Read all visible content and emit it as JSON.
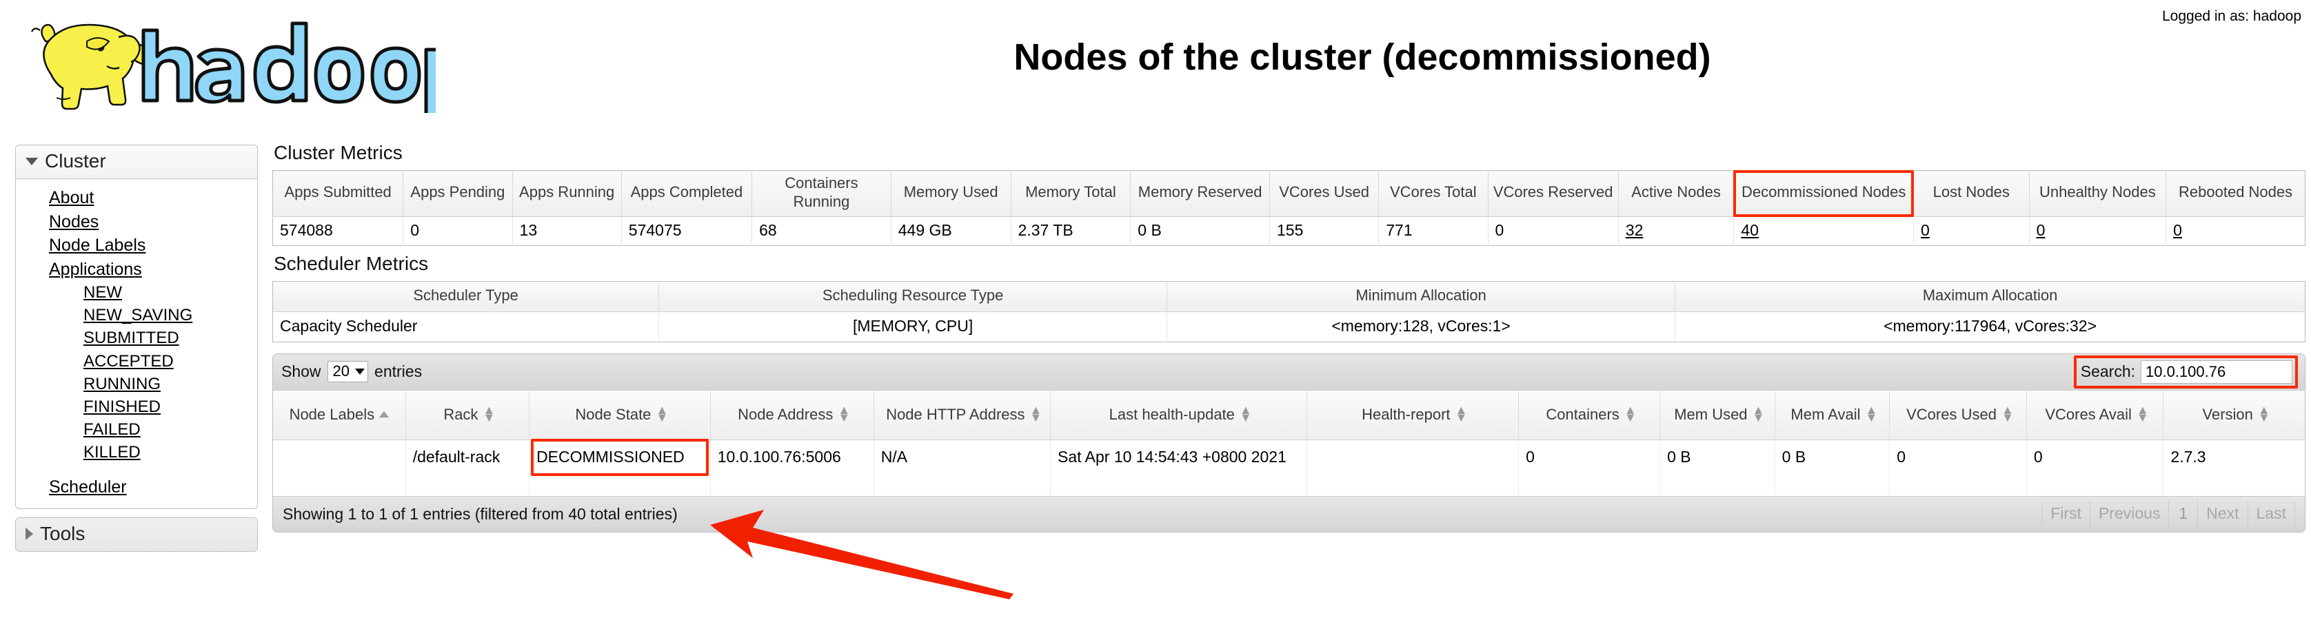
{
  "header": {
    "logo_alt": "hadoop",
    "title": "Nodes of the cluster (decommissioned)",
    "logged_in": "Logged in as: hadoop"
  },
  "sidebar": {
    "cluster": {
      "label": "Cluster",
      "items": [
        {
          "label": "About",
          "level": 1
        },
        {
          "label": "Nodes",
          "level": 1
        },
        {
          "label": "Node Labels",
          "level": 1
        },
        {
          "label": "Applications",
          "level": 1
        },
        {
          "label": "NEW",
          "level": 2
        },
        {
          "label": "NEW_SAVING",
          "level": 2
        },
        {
          "label": "SUBMITTED",
          "level": 2
        },
        {
          "label": "ACCEPTED",
          "level": 2
        },
        {
          "label": "RUNNING",
          "level": 2
        },
        {
          "label": "FINISHED",
          "level": 2
        },
        {
          "label": "FAILED",
          "level": 2
        },
        {
          "label": "KILLED",
          "level": 2
        },
        {
          "label": "Scheduler",
          "level": 1
        }
      ]
    },
    "tools": {
      "label": "Tools"
    }
  },
  "cluster_metrics": {
    "heading": "Cluster Metrics",
    "columns": [
      "Apps Submitted",
      "Apps Pending",
      "Apps Running",
      "Apps Completed",
      "Containers Running",
      "Memory Used",
      "Memory Total",
      "Memory Reserved",
      "VCores Used",
      "VCores Total",
      "VCores Reserved",
      "Active Nodes",
      "Decommissioned Nodes",
      "Lost Nodes",
      "Unhealthy Nodes",
      "Rebooted Nodes"
    ],
    "values": [
      "574088",
      "0",
      "13",
      "574075",
      "68",
      "449 GB",
      "2.37 TB",
      "0 B",
      "155",
      "771",
      "0",
      "32",
      "40",
      "0",
      "0",
      "0"
    ],
    "linked_value_indexes": [
      11,
      12,
      13,
      14,
      15
    ],
    "highlight_column_index": 12
  },
  "scheduler_metrics": {
    "heading": "Scheduler Metrics",
    "columns": [
      "Scheduler Type",
      "Scheduling Resource Type",
      "Minimum Allocation",
      "Maximum Allocation"
    ],
    "values": [
      "Capacity Scheduler",
      "[MEMORY, CPU]",
      "<memory:128, vCores:1>",
      "<memory:117964, vCores:32>"
    ]
  },
  "nodes_table": {
    "show_label": "Show",
    "entries_label": "entries",
    "page_length": "20",
    "search_label": "Search:",
    "search_value": "10.0.100.76",
    "search_placeholder": "",
    "columns": [
      {
        "label": "Node Labels",
        "sort": "asc"
      },
      {
        "label": "Rack",
        "sort": "both"
      },
      {
        "label": "Node State",
        "sort": "both"
      },
      {
        "label": "Node Address",
        "sort": "both"
      },
      {
        "label": "Node HTTP Address",
        "sort": "both"
      },
      {
        "label": "Last health-update",
        "sort": "both"
      },
      {
        "label": "Health-report",
        "sort": "both"
      },
      {
        "label": "Containers",
        "sort": "both"
      },
      {
        "label": "Mem Used",
        "sort": "both"
      },
      {
        "label": "Mem Avail",
        "sort": "both"
      },
      {
        "label": "VCores Used",
        "sort": "both"
      },
      {
        "label": "VCores Avail",
        "sort": "both"
      },
      {
        "label": "Version",
        "sort": "both"
      }
    ],
    "rows": [
      {
        "node_labels": "",
        "rack": "/default-rack",
        "node_state": "DECOMMISSIONED",
        "node_address": "10.0.100.76:5006",
        "node_http_address": "N/A",
        "last_health_update": "Sat Apr 10 14:54:43 +0800 2021",
        "health_report": "",
        "containers": "0",
        "mem_used": "0 B",
        "mem_avail": "0 B",
        "vcores_used": "0",
        "vcores_avail": "0",
        "version": "2.7.3"
      }
    ],
    "info": "Showing 1 to 1 of 1 entries (filtered from 40 total entries)",
    "paginate": {
      "first": "First",
      "previous": "Previous",
      "page": "1",
      "next": "Next",
      "last": "Last"
    }
  },
  "annotations": {
    "highlight_color": "#fa2a00",
    "arrow_color": "#f02000"
  }
}
